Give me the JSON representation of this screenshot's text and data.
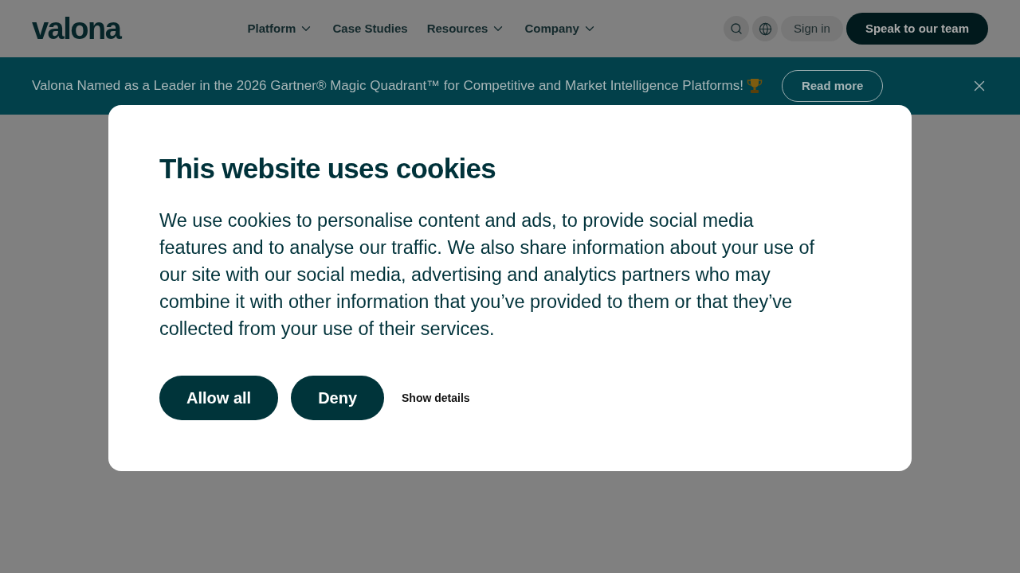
{
  "header": {
    "logo": "valona",
    "nav": [
      {
        "label": "Platform",
        "kind": "dropdown"
      },
      {
        "label": "Case Studies",
        "kind": "link"
      },
      {
        "label": "Resources",
        "kind": "dropdown"
      },
      {
        "label": "Company",
        "kind": "dropdown"
      }
    ],
    "sign_in": "Sign in",
    "cta": "Speak to our team"
  },
  "banner": {
    "text": "Valona Named as a Leader in the 2026 Gartner® Magic Quadrant™ for Competitive and Market Intelligence Platforms!",
    "button": "Read more"
  },
  "cookie_dialog": {
    "title": "This website uses cookies",
    "body": "We use cookies to personalise content and ads, to provide social media features and to analyse our traffic. We also share information about your use of our site with our social media, advertising and analytics partners who may combine it with other information that you’ve provided to them or that they’ve collected from your use of their services.",
    "buttons": [
      {
        "label": "Allow all",
        "kind": "primary"
      },
      {
        "label": "Deny",
        "kind": "primary"
      },
      {
        "label": "Show details",
        "kind": "link"
      }
    ]
  }
}
